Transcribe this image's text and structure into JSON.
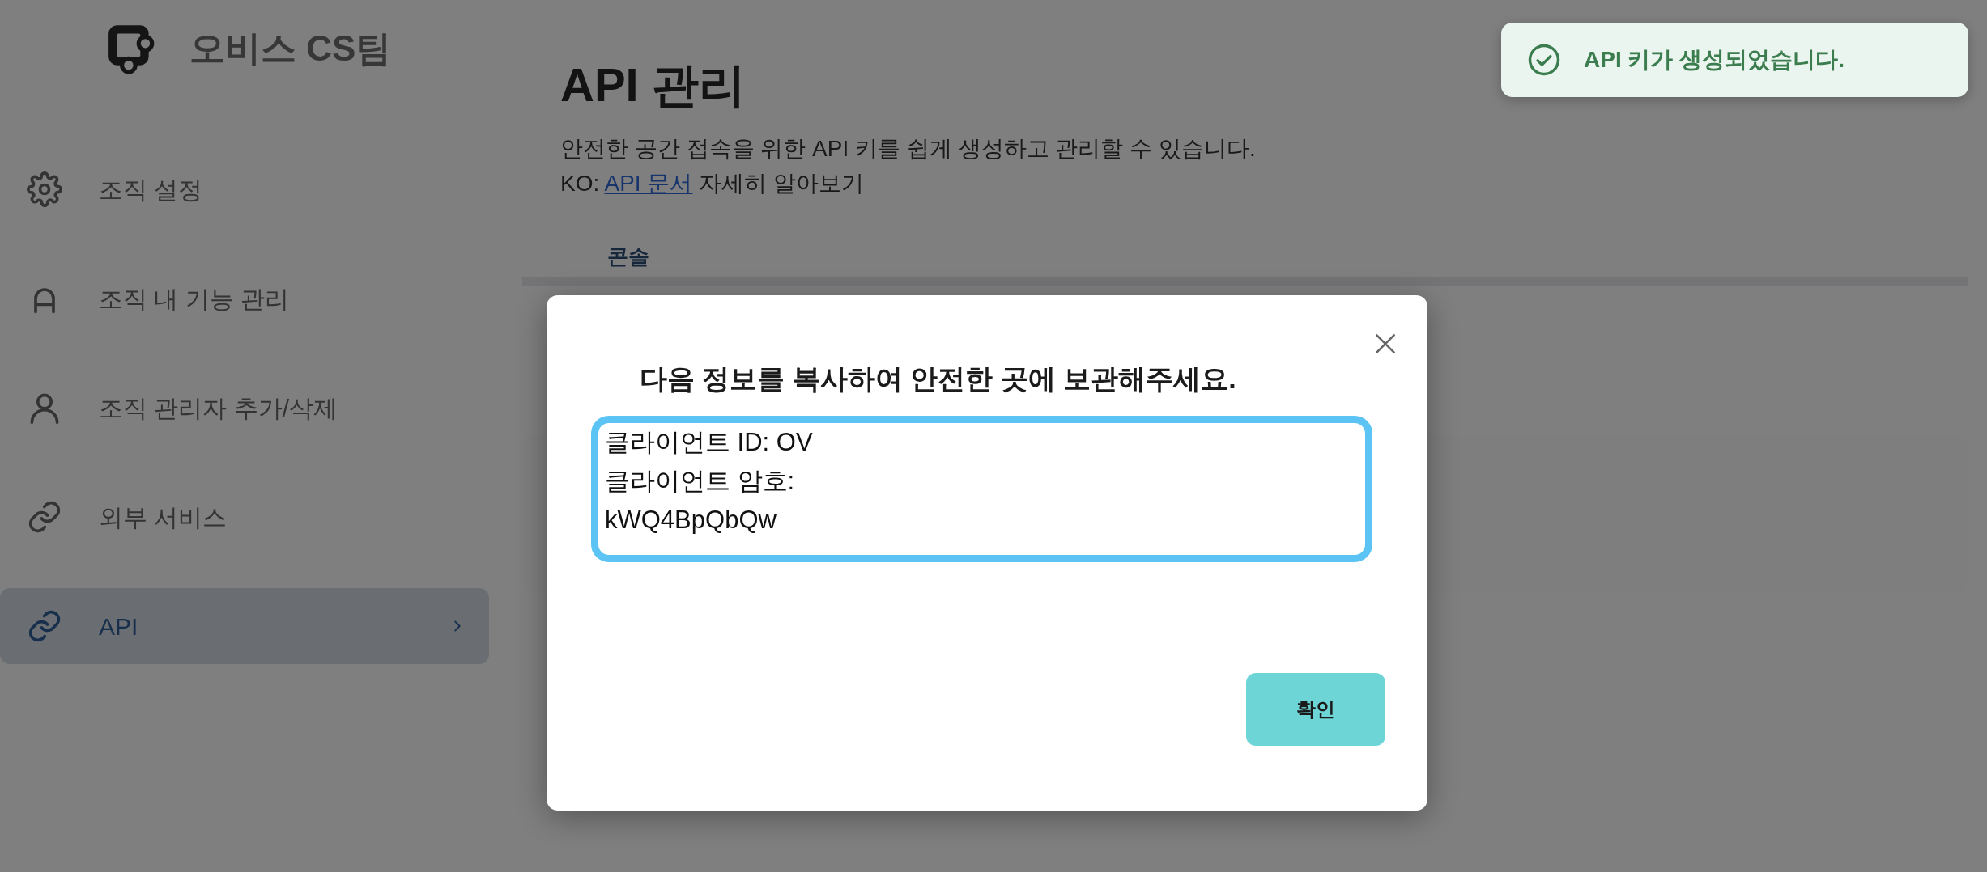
{
  "sidebar": {
    "brand": "오비스 CS팀",
    "items": [
      {
        "label": "조직 설정",
        "selected": false
      },
      {
        "label": "조직 내 기능 관리",
        "selected": false
      },
      {
        "label": "조직 관리자 추가/삭제",
        "selected": false
      },
      {
        "label": "외부 서비스",
        "selected": false
      },
      {
        "label": "API",
        "selected": true
      }
    ]
  },
  "page": {
    "title": "API 관리",
    "description": "안전한 공간 접속을 위한 API 키를 쉽게 생성하고 관리할 수 있습니다.",
    "doc_prefix": "KO:",
    "doc_link": "API 문서",
    "doc_suffix": "자세히 알아보기",
    "tabs": [
      {
        "label": "콘솔",
        "selected": true
      }
    ]
  },
  "modal": {
    "heading": "다음 정보를 복사하여 안전한 곳에 보관해주세요.",
    "lines": [
      "클라이언트 ID: OV",
      "클라이언트 암호:",
      "kWQ4BpQbQw"
    ],
    "confirm_button": "확인"
  },
  "toast": {
    "kind": "success",
    "message": "API 키가 생성되었습니다."
  }
}
